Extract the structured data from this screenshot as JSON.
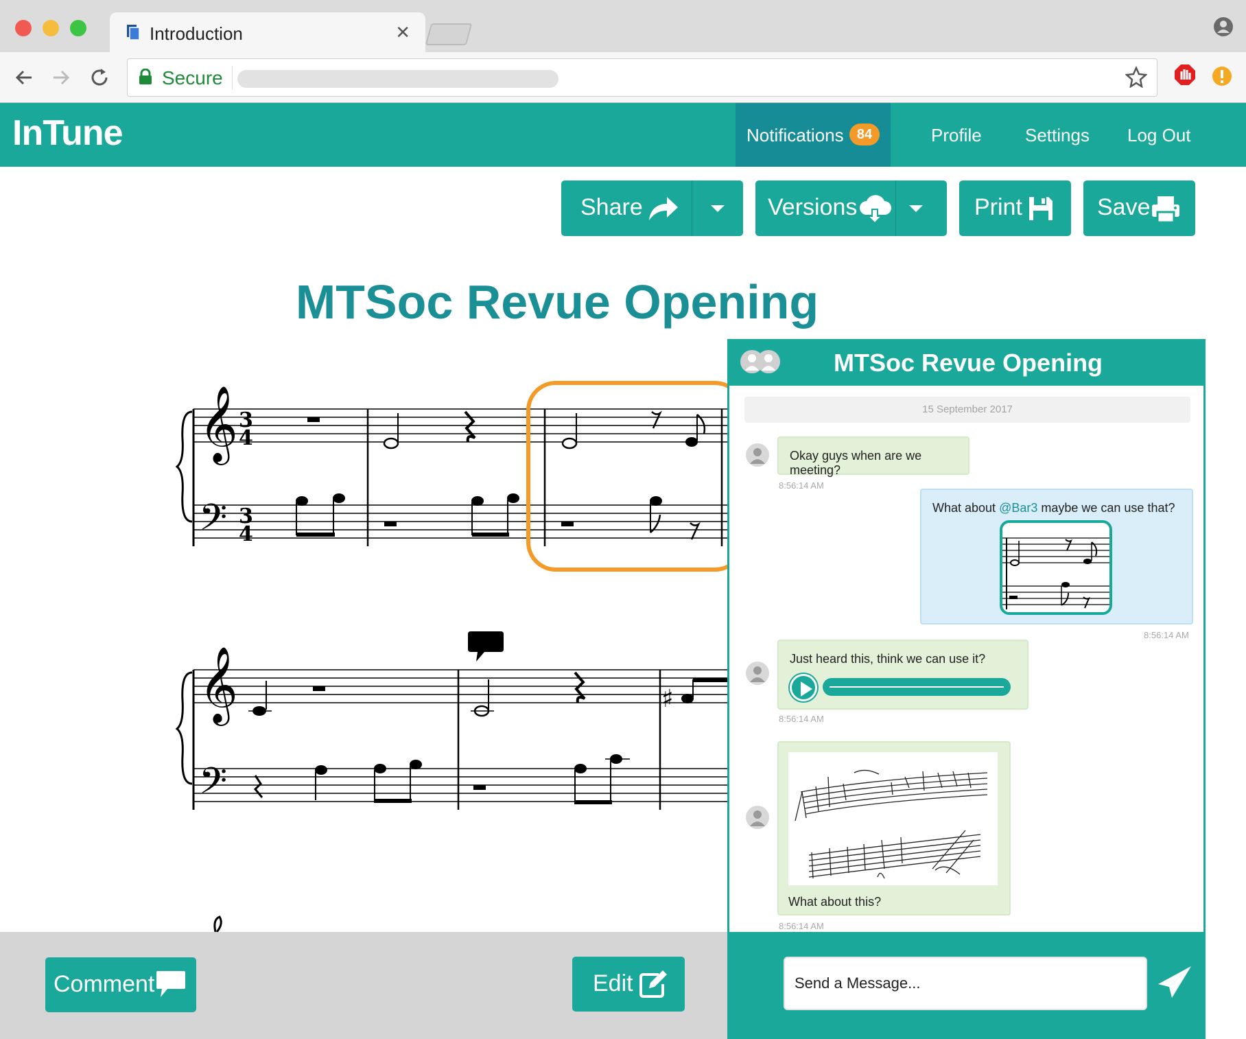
{
  "browser": {
    "tab_title": "Introduction",
    "secure_label": "Secure"
  },
  "app": {
    "brand": "InTune",
    "nav": {
      "notifications_label": "Notifications",
      "notifications_count": "84",
      "profile_label": "Profile",
      "settings_label": "Settings",
      "logout_label": "Log Out"
    },
    "actions": {
      "share": "Share",
      "versions": "Versions",
      "print": "Print",
      "save": "Save"
    },
    "document_title": "MTSoc Revue Opening"
  },
  "score": {
    "time_signature_top": "3",
    "time_signature_bottom": "4"
  },
  "chat": {
    "title": "MTSoc Revue Opening",
    "date": "15 September 2017",
    "messages": [
      {
        "text": "Okay guys when are we meeting?",
        "time": "8:56:14 AM"
      },
      {
        "text_before": "What about ",
        "mention": "@Bar3",
        "text_after": " maybe we can use that?",
        "time": "8:56:14 AM"
      },
      {
        "text": "Just heard this, think we can use it?",
        "time": "8:56:14 AM"
      },
      {
        "text": "What about this?",
        "time": "8:56:14 AM"
      }
    ],
    "input_placeholder": "Send a Message..."
  },
  "bottom": {
    "comment": "Comment",
    "edit": "Edit"
  },
  "colors": {
    "brand_teal": "#1aa89a",
    "title_teal": "#1a8f96",
    "notification_badge": "#f39a28",
    "selection_orange": "#f39a28",
    "chat_bubble_green": "#e3f1d8",
    "chat_bubble_blue": "#d9eef8"
  }
}
